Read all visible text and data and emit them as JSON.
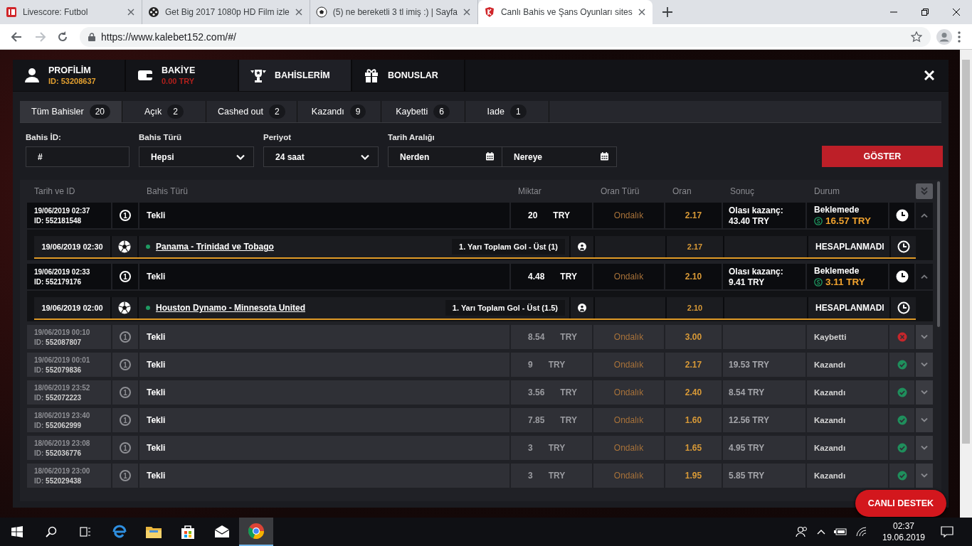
{
  "browser": {
    "tabs": [
      {
        "title": "Livescore: Futbol",
        "selected": false
      },
      {
        "title": "Get Big 2017 1080p HD Film izle",
        "selected": false
      },
      {
        "title": "(5) ne bereketli 3 tl imiş :) | Sayfa",
        "selected": false
      },
      {
        "title": "Canlı Bahis ve Şans Oyunları sites",
        "selected": true
      }
    ],
    "url": "https://www.kalebet152.com/#/"
  },
  "account_tabs": [
    {
      "kind": "profile",
      "label": "PROFİLİM",
      "sub": "ID: 53208637",
      "selected": false
    },
    {
      "kind": "balance",
      "label": "BAKİYE",
      "sub": "0.00 TRY",
      "selected": false
    },
    {
      "kind": "bets",
      "label": "BAHİSLERİM",
      "selected": true
    },
    {
      "kind": "bonus",
      "label": "BONUSLAR",
      "selected": false
    }
  ],
  "filter_tabs": [
    {
      "label": "Tüm Bahisler",
      "count": "20",
      "selected": true
    },
    {
      "label": "Açık",
      "count": "2",
      "selected": false
    },
    {
      "label": "Cashed out",
      "count": "2",
      "selected": false
    },
    {
      "label": "Kazandı",
      "count": "9",
      "selected": false
    },
    {
      "label": "Kaybetti",
      "count": "6",
      "selected": false
    },
    {
      "label": "Iade",
      "count": "1",
      "selected": false
    }
  ],
  "filters": {
    "bet_id": {
      "label": "Bahis İD:",
      "placeholder": "#"
    },
    "bet_type": {
      "label": "Bahis Türü",
      "value": "Hepsi"
    },
    "period": {
      "label": "Periyot",
      "value": "24 saat"
    },
    "date_range": {
      "label": "Tarih Aralığı",
      "from_placeholder": "Nerden",
      "to_placeholder": "Nereye"
    },
    "submit": "GÖSTER"
  },
  "table": {
    "columns": [
      "Tarih ve ID",
      "Bahis Türü",
      "Miktar",
      "Oran Türü",
      "Oran",
      "Sonuç",
      "Durum"
    ],
    "rows": [
      {
        "kind": "open",
        "date": "19/06/2019 02:37",
        "id": "ID: 552181548",
        "count": "1",
        "type": "Tekli",
        "amount": "20",
        "currency": "TRY",
        "odds_type": "Ondalık",
        "odds": "2.17",
        "result_label": "Olası kazanç:",
        "result": "43.40 TRY",
        "status": "Beklemede",
        "cashout": "16.57 TRY",
        "expanded": true,
        "selections": [
          {
            "date": "19/06/2019 02:30",
            "match": "Panama - Trinidad ve Tobago",
            "market": "1. Yarı Toplam Gol - Üst (1)",
            "odds": "2.17",
            "status": "HESAPLANMADI"
          }
        ]
      },
      {
        "kind": "open",
        "date": "19/06/2019 02:33",
        "id": "ID: 552179176",
        "count": "1",
        "type": "Tekli",
        "amount": "4.48",
        "currency": "TRY",
        "odds_type": "Ondalık",
        "odds": "2.10",
        "result_label": "Olası kazanç:",
        "result": "9.41 TRY",
        "status": "Beklemede",
        "cashout": "3.11 TRY",
        "expanded": true,
        "selections": [
          {
            "date": "19/06/2019 02:00",
            "match": "Houston Dynamo - Minnesota United",
            "market": "1. Yarı Toplam Gol - Üst (1.5)",
            "odds": "2.10",
            "status": "HESAPLANMADI"
          }
        ]
      },
      {
        "kind": "settled",
        "date": "19/06/2019 00:10",
        "id": "ID: **552087807**",
        "count": "1",
        "type": "Tekli",
        "amount": "8.54",
        "currency": "TRY",
        "odds_type": "Ondalık",
        "odds": "3.00",
        "status": "Kaybetti",
        "won": false,
        "expanded": false
      },
      {
        "kind": "settled",
        "date": "19/06/2019 00:01",
        "id": "ID: **552079836**",
        "count": "1",
        "type": "Tekli",
        "amount": "9",
        "currency": "TRY",
        "odds_type": "Ondalık",
        "odds": "2.17",
        "result": "19.53 TRY",
        "status": "Kazandı",
        "won": true,
        "expanded": false
      },
      {
        "kind": "settled",
        "date": "18/06/2019 23:52",
        "id": "ID: **552072223**",
        "count": "1",
        "type": "Tekli",
        "amount": "3.56",
        "currency": "TRY",
        "odds_type": "Ondalık",
        "odds": "2.40",
        "result": "8.54 TRY",
        "status": "Kazandı",
        "won": true,
        "expanded": false
      },
      {
        "kind": "settled",
        "date": "18/06/2019 23:40",
        "id": "ID: **552062999**",
        "count": "1",
        "type": "Tekli",
        "amount": "7.85",
        "currency": "TRY",
        "odds_type": "Ondalık",
        "odds": "1.60",
        "result": "12.56 TRY",
        "status": "Kazandı",
        "won": true,
        "expanded": false
      },
      {
        "kind": "settled",
        "date": "18/06/2019 23:08",
        "id": "ID: **552036776**",
        "count": "1",
        "type": "Tekli",
        "amount": "3",
        "currency": "TRY",
        "odds_type": "Ondalık",
        "odds": "1.65",
        "result": "4.95 TRY",
        "status": "Kazandı",
        "won": true,
        "expanded": false
      },
      {
        "kind": "settled",
        "date": "18/06/2019 23:00",
        "id": "ID: **552029438**",
        "count": "1",
        "type": "Tekli",
        "amount": "3",
        "currency": "TRY",
        "odds_type": "Ondalık",
        "odds": "1.95",
        "result": "5.85 TRY",
        "status": "Kazandı",
        "won": true,
        "expanded": false
      }
    ]
  },
  "support": "CANLI DESTEK",
  "taskbar": {
    "time": "02:37",
    "date": "19.06.2019"
  }
}
